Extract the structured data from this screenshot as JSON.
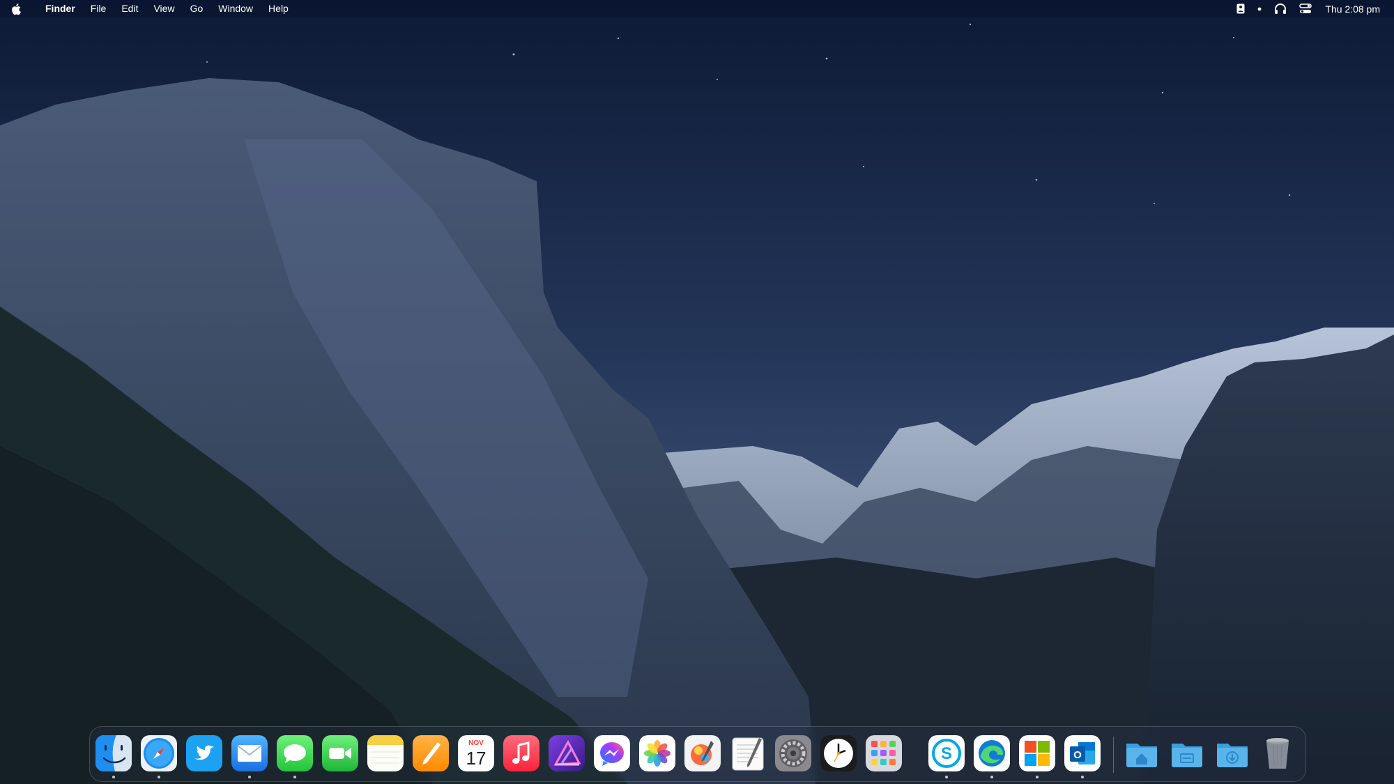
{
  "menubar": {
    "app_name": "Finder",
    "menus": [
      "File",
      "Edit",
      "View",
      "Go",
      "Window",
      "Help"
    ],
    "clock": "Thu 2:08 pm",
    "status_icons": [
      "user-account-icon",
      "dot-icon",
      "headphones-icon",
      "control-center-icon"
    ]
  },
  "dock": {
    "apps": [
      {
        "name": "Finder",
        "icon": "finder-icon",
        "running": true
      },
      {
        "name": "Safari",
        "icon": "safari-icon",
        "running": true
      },
      {
        "name": "Twitter",
        "icon": "twitter-icon",
        "running": false
      },
      {
        "name": "Mail",
        "icon": "mail-icon",
        "running": true
      },
      {
        "name": "Messages",
        "icon": "messages-icon",
        "running": true
      },
      {
        "name": "FaceTime",
        "icon": "facetime-icon",
        "running": false
      },
      {
        "name": "Notes",
        "icon": "notes-icon",
        "running": false
      },
      {
        "name": "Pages",
        "icon": "pages-icon",
        "running": false
      },
      {
        "name": "Calendar",
        "icon": "calendar-icon",
        "running": false,
        "month": "NOV",
        "day": "17"
      },
      {
        "name": "Music",
        "icon": "music-icon",
        "running": false
      },
      {
        "name": "Affinity Designer",
        "icon": "affinity-icon",
        "running": false
      },
      {
        "name": "Messenger",
        "icon": "messenger-icon",
        "running": false
      },
      {
        "name": "Photos",
        "icon": "photos-icon",
        "running": false
      },
      {
        "name": "Pixelmator",
        "icon": "pixelmator-icon",
        "running": false
      },
      {
        "name": "TextEdit",
        "icon": "textedit-icon",
        "running": false
      },
      {
        "name": "System Preferences",
        "icon": "system-preferences-icon",
        "running": false
      },
      {
        "name": "Clock",
        "icon": "clock-icon",
        "running": false
      },
      {
        "name": "Launchpad",
        "icon": "launchpad-icon",
        "running": false
      },
      {
        "name": "Skype",
        "icon": "skype-icon",
        "running": true
      },
      {
        "name": "Microsoft Edge",
        "icon": "edge-icon",
        "running": true
      },
      {
        "name": "Microsoft Store",
        "icon": "microsoft-store-icon",
        "running": true
      },
      {
        "name": "Outlook",
        "icon": "outlook-icon",
        "running": true
      }
    ],
    "stacks": [
      {
        "name": "Home",
        "icon": "home-folder-icon"
      },
      {
        "name": "Documents",
        "icon": "documents-folder-icon"
      },
      {
        "name": "Downloads",
        "icon": "downloads-folder-icon"
      },
      {
        "name": "Trash",
        "icon": "trash-icon"
      }
    ]
  },
  "colors": {
    "sky_top": "#0f1e3d",
    "sky_mid": "#2a3d63",
    "rock": "#3a4a63",
    "forest": "#1c2a2e",
    "folder_blue": "#5ab4ec"
  }
}
